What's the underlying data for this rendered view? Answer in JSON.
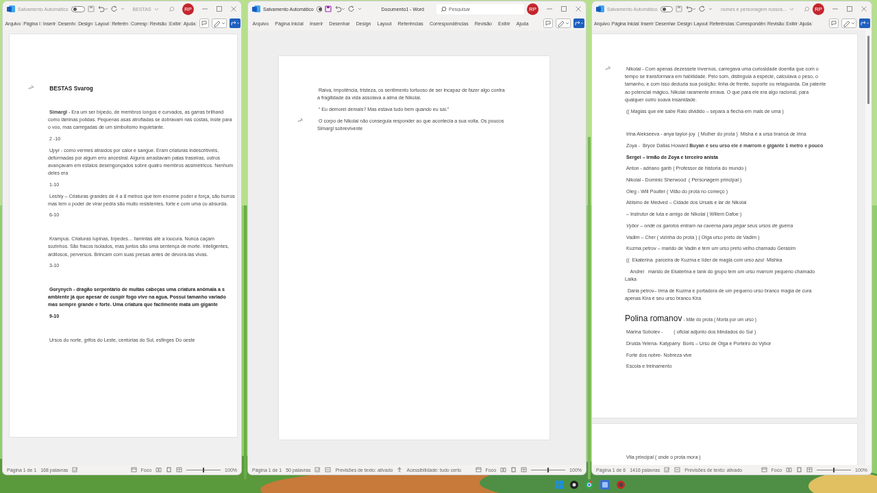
{
  "windows": [
    {
      "active": false,
      "autosave_label": "Salvamento Automático",
      "autosave_on": false,
      "title": "BESTAS",
      "title_caret": true,
      "avatar": "RP",
      "tabs": [
        "Arquivo",
        "Página I",
        "Inserir",
        "Desenhı",
        "Design",
        "Layout",
        "Referên",
        "Corresp",
        "Revisão",
        "Exibir",
        "Ajuda"
      ],
      "pages": [
        {
          "paragraphs": [
            {
              "kind": "heading",
              "text": "BESTAS Svarog",
              "mark": true
            },
            {
              "kind": "body",
              "space_before": true,
              "text": "**Simargl** - Era um ser bípedo, de membros longos e curvados, as garras brilhand como lâminas polidas. Pequenas asas atrofiadas se dobravam nas costas, inúte para o voo, mas carregadas de um simbolismo inquietante."
            },
            {
              "kind": "body",
              "text": "2 -10"
            },
            {
              "kind": "body",
              "text": "Upyr - como vermes atraídos por calor e sangue. Eram criaturas indescritíveis, deformadas por algum erro ancestral. Alguns arrastavam patas traseiras, outros avançavam em estalos desengonçados sobre quatro membros assimétricos. Nenhum deles era"
            },
            {
              "kind": "body",
              "text": "1-10"
            },
            {
              "kind": "body",
              "text": "Leshiy – Criaturas grandes de 4 a 8 metros que tem enorme poder e força, são burros mas tem o poder de virar pedra são muito resistentes, forte e com uma cu absurda."
            },
            {
              "kind": "body",
              "text": "6-10"
            },
            {
              "kind": "body",
              "space_before": true,
              "text": "Krampus. Criaturas lupinas, bípedes… famintas até a loucura. Nunca caçam sozinhos. São fracos isolados, mas juntos são uma sentença de morte. Inteligentes, ardilosos, perversos. Brincam com suas presas antes de devorá-las vivas."
            },
            {
              "kind": "body",
              "text": "3-10"
            },
            {
              "kind": "bold",
              "space_before": true,
              "text": "Gorynych - dragão serpentário de muitas cabeças uma criatura anômala a s ambiente já que apesar de cuspir fogo vive na agua. Possui tamanho variado mas sempre grande e forte. Uma criatura que facilmente mata um gigante"
            },
            {
              "kind": "bold",
              "text": "9-10"
            },
            {
              "kind": "body",
              "space_before": true,
              "text": "Ursos do norte, grifos do Leste, centúrias do Sul, esfinges Do oeste"
            }
          ]
        }
      ],
      "status": {
        "items": [
          {
            "kind": "text",
            "text": "Página 1 de 1"
          },
          {
            "kind": "text",
            "text": "168 palavras"
          },
          {
            "kind": "proofing"
          }
        ],
        "focus": "Foco",
        "zoom": {
          "level": 0.5,
          "reading": "100%"
        }
      }
    },
    {
      "active": true,
      "autosave_label": "Salvamento Automático",
      "autosave_on": false,
      "title": "Documento1 - Word",
      "title_caret": false,
      "search": {
        "placeholder": "Pesquisar"
      },
      "avatar": "RP",
      "tabs": [
        "Arquivo",
        "Página Inicial",
        "Inserir",
        "Desenhar",
        "Design",
        "Layout",
        "Referências",
        "Correspondências",
        "Revisão",
        "Exibir",
        "Ajuda"
      ],
      "pages": [
        {
          "paragraphs": [
            {
              "kind": "body",
              "text": "Raiva, impotência, tristeza, os sentimento tortuoso de ser incapaz de fazer algo contra a fragilidade da vida assolava a alma de Nikolai."
            },
            {
              "kind": "body",
              "text": "“ Eu demorei demais? Mas estava tudo bem quando eu saí.”"
            },
            {
              "kind": "body",
              "mark": true,
              "text": "O corpo de Nikolai não conseguia responder ao que acontecia a sua volta. Os poucos Simargl sobrevivente"
            }
          ]
        }
      ],
      "status": {
        "items": [
          {
            "kind": "text",
            "text": "Página 1 de 1"
          },
          {
            "kind": "text",
            "text": "50 palavras"
          },
          {
            "kind": "proofing"
          },
          {
            "kind": "predictions",
            "text": "Previsões de texto: ativado"
          },
          {
            "kind": "accessibility",
            "text": "Acessibilidade: tudo certo"
          }
        ],
        "focus": "Foco",
        "zoom": {
          "level": 0.5,
          "reading": "100%"
        }
      }
    },
    {
      "active": false,
      "autosave_label": "Salvamento Automático",
      "autosave_on": false,
      "title": "nomes e personagem russos...",
      "title_caret": true,
      "avatar": "RP",
      "tabs": [
        "Arquivo",
        "Página Inicial",
        "Inserir",
        "Desenhar",
        "Design",
        "Layout",
        "Referências",
        "Correspondên",
        "Revisão",
        "Exibir",
        "Ajuda"
      ],
      "pages": [
        {
          "paragraphs": [
            {
              "kind": "body",
              "mark": true,
              "text": "Nikolai - Com apenas dezessete invernos, carregava uma curiosidade doentia que com o tempo se transformara em habilidade. Pelo som, distinguia a espécie, calculava o peso, o tamanho, e com isso deduzia sua posição: linha de frente, suporte ou retaguarda. Da patente ao potencial mágico, Nikolai raramente errava. O que para ele era algo racional, para qualquer outro soava insanidade."
            },
            {
              "kind": "body",
              "text": "(( Magias que ele sabe Raio dividido – separa a flecha em mais de uma )"
            },
            {
              "kind": "body",
              "space_before": true,
              "text": "Irina Alekseeva - anya taylor-joy  ( Mulher do prota )  Misha é a ursa branca de Irina"
            },
            {
              "kind": "body",
              "text": "Zoya -  Bryce Dallas Howard **Buyan é seu urso ele é marrom e gigante 1 metro e pouco**"
            },
            {
              "kind": "bold",
              "text": "Sergei – irmão de Zoya e terceiro anista"
            },
            {
              "kind": "body",
              "text": "Anton - adriano garib ( Professor de historia do mundo )"
            },
            {
              "kind": "body",
              "text": "Nikolai - Dominic Sherwood  ( Personagem principal )"
            },
            {
              "kind": "body",
              "text": "Oleg - Will Poulter ( Vilão do prota no começo )"
            },
            {
              "kind": "body",
              "text": "Abismo de Medved – Cidade dos Ursais e lar de Nikolai"
            },
            {
              "kind": "body",
              "text": "– Instrutor de luta e amigo de Nikolai ( Willem Dafoe )"
            },
            {
              "kind": "italic",
              "text": "Vybor – onde os garotos entram na caverna para pegar seus ursos de guerra"
            },
            {
              "kind": "body",
              "text": "Vadim – Cher ( vizinha do prota ) ( Olga urso preto de Vadim )"
            },
            {
              "kind": "body",
              "text": "Kuzma petrov – marido de Vadin e tem um urso preto velho chamado Gerasim"
            },
            {
              "kind": "body",
              "text": "((  Ekaterina  parceira de Kuzma e líder de magia com urso azul  Mishka"
            },
            {
              "kind": "body",
              "text": "   Andrei   marido de Ekaterina e tank do grupo tem um urso marrom pequeno chamado Laika"
            },
            {
              "kind": "body",
              "text": " Daria petrov– Irma de Kuzma e portadora de um pequeno urso branco magia de cura apenas Kira é seu urso branco Kira"
            },
            {
              "kind": "name-heading",
              "title": "Polina romanov",
              "text": "- Mãe do prota ( Morta por um urso )"
            },
            {
              "kind": "body",
              "text": "Marina Sobolev -        ( oficial adjunto dos blindados do Sul )"
            },
            {
              "kind": "body",
              "text": "Druida Yelena- Katyparry  Boris – Urso de Olga e Porteiro do Vybor"
            },
            {
              "kind": "body",
              "text": "Forte dos nobre- Nobreza vive"
            },
            {
              "kind": "body",
              "text": "Escola e treinamento"
            }
          ]
        },
        {
          "paragraphs": [
            {
              "kind": "body",
              "text": "Vila principal ( onde o prota mora )"
            }
          ]
        }
      ],
      "status": {
        "items": [
          {
            "kind": "text",
            "text": "Página 1 de 6"
          },
          {
            "kind": "text",
            "text": "1416 palavras"
          },
          {
            "kind": "proofing"
          },
          {
            "kind": "predictions",
            "text": "Previsões de texto: ativado"
          }
        ],
        "focus": "Foco",
        "zoom": {
          "level": 0.5,
          "reading": "100%"
        }
      }
    }
  ]
}
